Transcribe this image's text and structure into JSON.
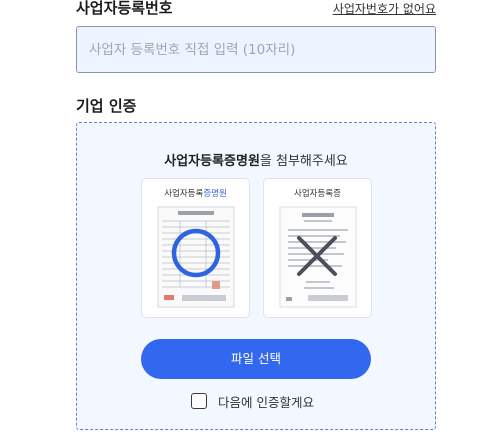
{
  "business_number": {
    "title": "사업자등록번호",
    "no_number_link": "사업자번호가 없어요",
    "placeholder": "사업자 등록번호 직접 입력 (10자리)",
    "value": ""
  },
  "company_verify": {
    "title": "기업 인증",
    "instruction_bold": "사업자등록증명원",
    "instruction_rest": "을 첨부해주세요",
    "samples": [
      {
        "label_prefix": "사업자등록",
        "label_highlight": "증명원",
        "mark": "circle-icon",
        "mark_color": "#2f64e0"
      },
      {
        "label": "사업자등록증",
        "mark": "x-icon",
        "mark_color": "#4a4f5c"
      }
    ],
    "file_button": "파일 선택",
    "later_checkbox": {
      "label": "다음에 인증할게요",
      "checked": false
    }
  },
  "colors": {
    "primary": "#3267ef",
    "input_bg": "#eef4ff",
    "box_border": "#5b84d6"
  }
}
